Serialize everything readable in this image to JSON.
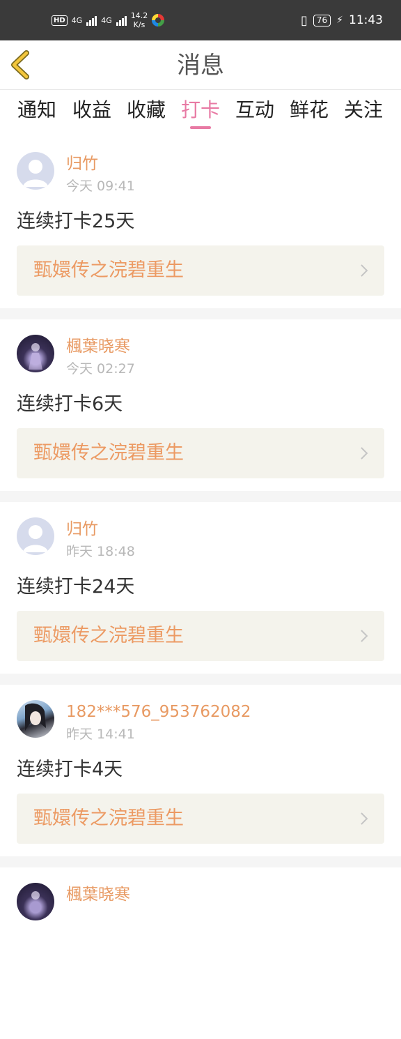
{
  "status_bar": {
    "hd": "HD",
    "net1": "4G",
    "net2": "4G",
    "speed_value": "14.2",
    "speed_unit": "K/s",
    "battery": "76",
    "time": "11:43"
  },
  "header": {
    "title": "消息"
  },
  "tabs": [
    {
      "label": "通知"
    },
    {
      "label": "收益"
    },
    {
      "label": "收藏"
    },
    {
      "label": "打卡"
    },
    {
      "label": "互动"
    },
    {
      "label": "鲜花"
    },
    {
      "label": "关注"
    }
  ],
  "active_tab_index": 3,
  "messages": [
    {
      "user": "归竹",
      "time": "今天 09:41",
      "text": "连续打卡25天",
      "book": "甄嬛传之浣碧重生"
    },
    {
      "user": "楓葉晓寒",
      "time": "今天 02:27",
      "text": "连续打卡6天",
      "book": "甄嬛传之浣碧重生"
    },
    {
      "user": "归竹",
      "time": "昨天 18:48",
      "text": "连续打卡24天",
      "book": "甄嬛传之浣碧重生"
    },
    {
      "user": "182***576_953762082",
      "time": "昨天 14:41",
      "text": "连续打卡4天",
      "book": "甄嬛传之浣碧重生"
    },
    {
      "user": "楓葉晓寒",
      "time": "",
      "text": "",
      "book": ""
    }
  ],
  "colors": {
    "accent_pink": "#e87aa4",
    "username_orange": "#e89a63",
    "book_bg": "#f4f3ec",
    "status_bar_bg": "#3a3a3a"
  }
}
